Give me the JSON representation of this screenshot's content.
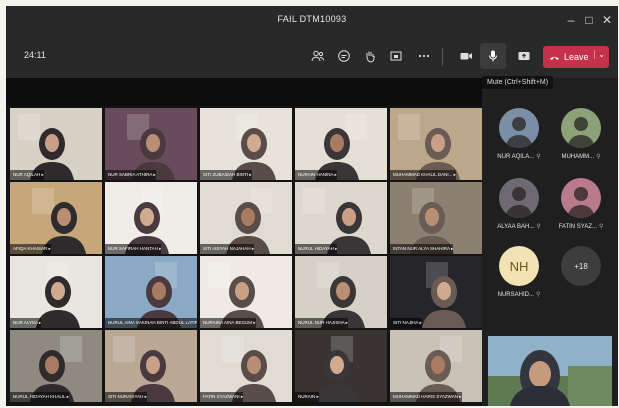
{
  "window": {
    "title": "FAIL DTM10093",
    "minimize_icon": "minimize-icon",
    "maximize_icon": "maximize-icon",
    "close_icon": "close-icon"
  },
  "toolbar": {
    "timer": "24:11",
    "leave_label": "Leave",
    "mic_tooltip": "Mute (Ctrl+Shift+M)",
    "icons": [
      "people-icon",
      "chat-icon",
      "raise-hand-icon",
      "breakout-rooms-icon",
      "more-icon",
      "camera-icon",
      "microphone-icon",
      "share-icon",
      "phone-icon"
    ]
  },
  "tiles": [
    {
      "name": "NUR AQILAH ▸",
      "bg": "#d8d2c6"
    },
    {
      "name": "NUR SABRIA ATHIRA ▸",
      "bg": "#6a4b5b"
    },
    {
      "name": "SITI ZUBAIDAH BINTI ▸",
      "bg": "#e7e3da"
    },
    {
      "name": "NURAIN HANINA ▸",
      "bg": "#e4e0d6"
    },
    {
      "name": "MUHAMMAD KHALIL DANI... ▸",
      "bg": "#bda78a"
    },
    {
      "name": "AFIQA KHAISAR ▸",
      "bg": "#c7a77a"
    },
    {
      "name": "NUR SAFIRAH HANTAH ▸",
      "bg": "#f0ede8"
    },
    {
      "name": "SITI AISYAH NAJAHAH ▸",
      "bg": "#e1dcd2"
    },
    {
      "name": "NURUL HIDAYAH ▸",
      "bg": "#ddd8ce"
    },
    {
      "name": "INTAN NUR ALYA SHAHIRA ▸",
      "bg": "#8c8070"
    },
    {
      "name": "NUR ALYSA ▸",
      "bg": "#e9e6e1"
    },
    {
      "name": "NURUL AINA SAKINAH BINTI ABDUL LATIF ▸",
      "bg": "#8aa9c4"
    },
    {
      "name": "NURAINA AINA BEGUM ▸",
      "bg": "#efebe4"
    },
    {
      "name": "NURUL NUR HAJISHA ▸",
      "bg": "#d6d1c6"
    },
    {
      "name": "SITI NAJIHA ▸",
      "bg": "#25252a"
    },
    {
      "name": "NURUL HIDAYAH KHALIL ▸",
      "bg": "#8e8a80"
    },
    {
      "name": "SITI NURAISYAH ▸",
      "bg": "#b9a894"
    },
    {
      "name": "FATIN SYAZWANI ▸",
      "bg": "#e0dcd4"
    },
    {
      "name": "NURAIN ▸",
      "bg": "#393431"
    },
    {
      "name": "MUHAMMAD HARIS SYAZWAN ▸",
      "bg": "#c8c2b6"
    }
  ],
  "side_participants": [
    {
      "name": "NUR AQILA...",
      "initials": ""
    },
    {
      "name": "MUHAMM...",
      "initials": ""
    },
    {
      "name": "ALYAA BAH...",
      "initials": ""
    },
    {
      "name": "FATIN SYAZ...",
      "initials": ""
    },
    {
      "name": "NURSAHID...",
      "initials": "NH"
    },
    {
      "name": "",
      "initials": "+18"
    }
  ],
  "colors": {
    "leave": "#c4314b",
    "titlebar": "#292929",
    "stage": "#141414"
  }
}
